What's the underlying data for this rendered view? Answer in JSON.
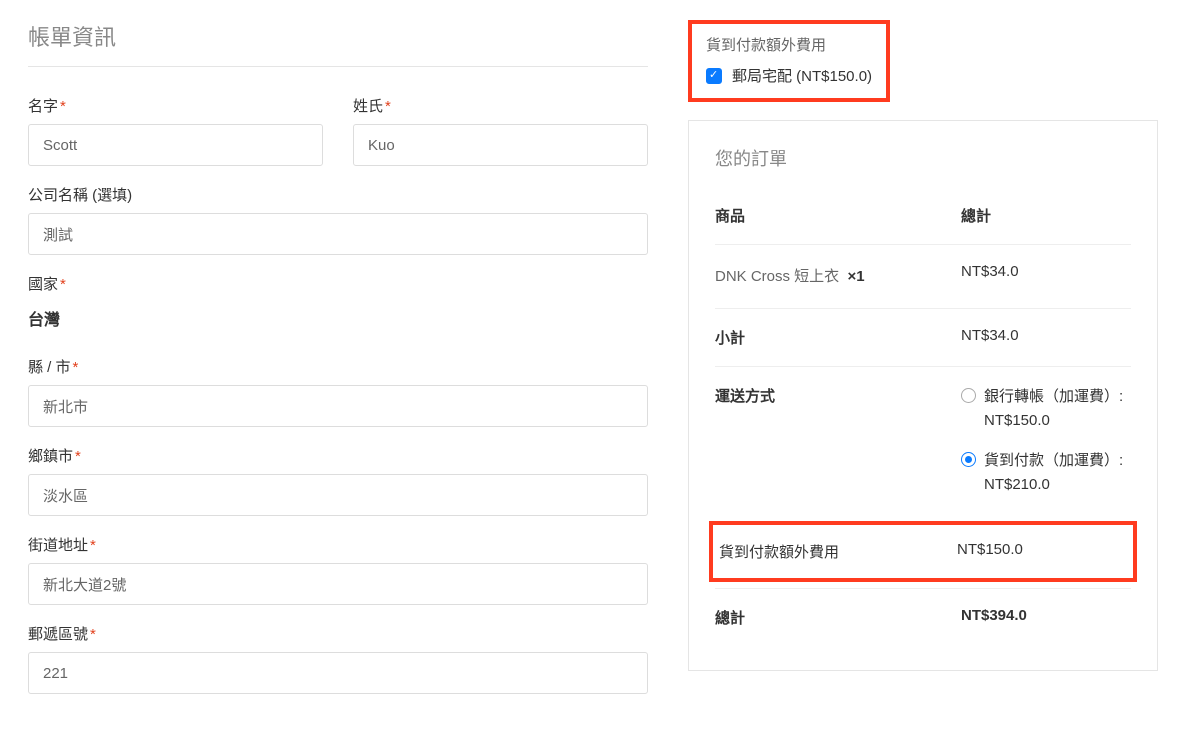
{
  "billing": {
    "title": "帳單資訊",
    "first_name_label": "名字",
    "first_name_value": "Scott",
    "last_name_label": "姓氏",
    "last_name_value": "Kuo",
    "company_label": "公司名稱 (選填)",
    "company_value": "測試",
    "country_label": "國家",
    "country_value": "台灣",
    "state_label": "縣 / 市",
    "state_value": "新北市",
    "city_label": "鄉鎮市",
    "city_value": "淡水區",
    "street_label": "街道地址",
    "street_value": "新北大道2號",
    "postcode_label": "郵遞區號",
    "postcode_value": "221"
  },
  "cod_extra": {
    "title": "貨到付款額外費用",
    "option_label": "郵局宅配 (NT$150.0)",
    "checked": true
  },
  "order": {
    "title": "您的訂單",
    "header_product": "商品",
    "header_total": "總計",
    "item_name": "DNK Cross 短上衣",
    "item_qty": "×1",
    "item_price": "NT$34.0",
    "subtotal_label": "小計",
    "subtotal_value": "NT$34.0",
    "shipping_label": "運送方式",
    "ship_opt1_label": "銀行轉帳（加運費）:",
    "ship_opt1_price": "NT$150.0",
    "ship_opt2_label": "貨到付款（加運費）:",
    "ship_opt2_price": "NT$210.0",
    "cod_fee_label": "貨到付款額外費用",
    "cod_fee_value": "NT$150.0",
    "total_label": "總計",
    "total_value": "NT$394.0"
  }
}
